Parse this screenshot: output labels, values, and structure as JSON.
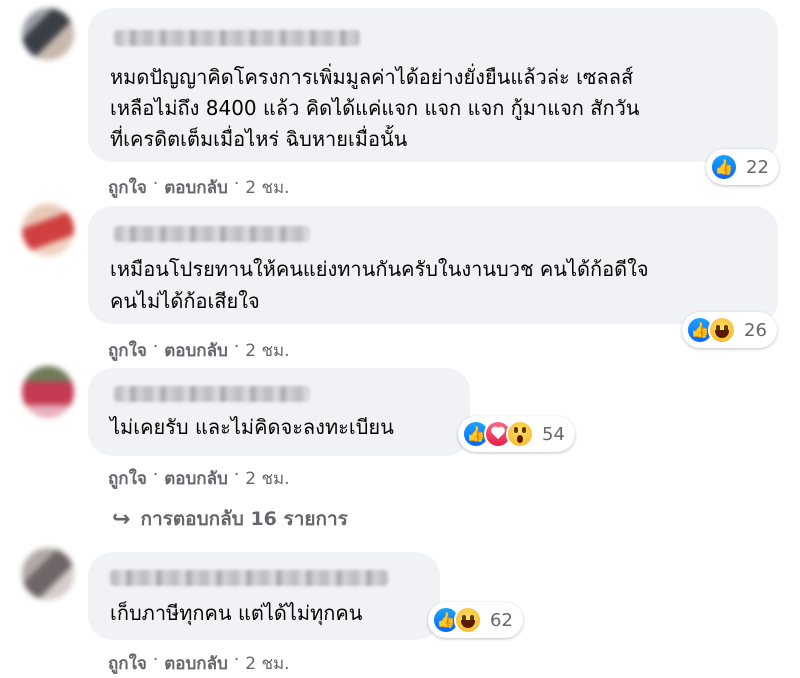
{
  "colors": {
    "like": "#0866ff",
    "love": "#e61e4d",
    "bubble": "#f0f2f5",
    "meta": "#65676b"
  },
  "actions": {
    "like": "ถูกใจ",
    "reply": "ตอบกลับ",
    "dot": "·"
  },
  "comments": [
    {
      "lines": [
        "หมดปัญญาคิดโครงการเพิ่มมูลค่าได้อย่างยั่งยืนแล้วล่ะ เซลลส์",
        "เหลือไม่ถึง 8400 แล้ว คิดได้แค่แจก แจก แจก กู้มาแจก สักวัน",
        "ที่เครดิตเต็มเมื่อไหร่ ฉิบหายเมื่อนั้น"
      ],
      "time": "2 ชม.",
      "reactions": [
        "like-icon"
      ],
      "reaction_count": "22"
    },
    {
      "lines": [
        "เหมือนโปรยทานให้คนแย่งทานกันครับในงานบวช คนได้ก้อดีใจ",
        "คนไม่ได้ก้อเสียใจ"
      ],
      "time": "2 ชม.",
      "reactions": [
        "like-icon",
        "haha-icon"
      ],
      "reaction_count": "26"
    },
    {
      "lines": [
        "ไม่เคยรับ และไม่คิดจะลงทะเบียน"
      ],
      "time": "2 ชม.",
      "reactions": [
        "like-icon",
        "love-icon",
        "wow-icon"
      ],
      "reaction_count": "54",
      "more_replies": "การตอบกลับ 16 รายการ"
    },
    {
      "lines": [
        "เก็บภาษีทุกคน แต่ได้ไม่ทุกคน"
      ],
      "time": "2 ชม.",
      "reactions": [
        "like-icon",
        "haha-icon"
      ],
      "reaction_count": "62"
    }
  ]
}
